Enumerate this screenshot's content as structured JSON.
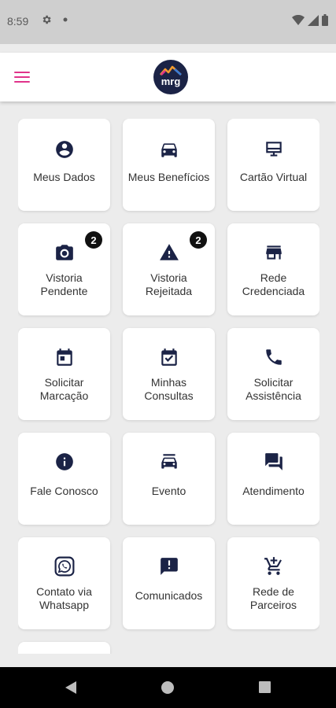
{
  "status_bar": {
    "time": "8:59",
    "icons": [
      "gear-icon",
      "dot-icon",
      "wifi-icon",
      "signal-icon",
      "battery-icon"
    ]
  },
  "app_bar": {
    "menu_icon": "hamburger-menu-icon",
    "logo_text": "mrg",
    "accent_color": "#e0338a",
    "logo_bg": "#1b2346"
  },
  "tiles": [
    {
      "label": "Meus Dados",
      "icon": "account-circle-icon"
    },
    {
      "label": "Meus Benefícios",
      "icon": "car-icon"
    },
    {
      "label": "Cartão Virtual",
      "icon": "card-monitor-icon"
    },
    {
      "label_lines": [
        "Vistoria",
        "Pendente"
      ],
      "icon": "camera-icon",
      "badge": "2"
    },
    {
      "label_lines": [
        "Vistoria",
        "Rejeitada"
      ],
      "icon": "warning-icon",
      "badge": "2"
    },
    {
      "label_lines": [
        "Rede",
        "Credenciada"
      ],
      "icon": "store-icon"
    },
    {
      "label_lines": [
        "Solicitar",
        "Marcação"
      ],
      "icon": "calendar-icon"
    },
    {
      "label_lines": [
        "Minhas",
        "Consultas"
      ],
      "icon": "calendar-check-icon"
    },
    {
      "label_lines": [
        "Solicitar",
        "Assistência"
      ],
      "icon": "phone-icon"
    },
    {
      "label": "Fale Conosco",
      "icon": "info-icon"
    },
    {
      "label": "Evento",
      "icon": "car-event-icon"
    },
    {
      "label": "Atendimento",
      "icon": "forum-icon"
    },
    {
      "label_lines": [
        "Contato via",
        "Whatsapp"
      ],
      "icon": "whatsapp-icon"
    },
    {
      "label": "Comunicados",
      "icon": "announcement-icon"
    },
    {
      "label_lines": [
        "Rede de",
        "Parceiros"
      ],
      "icon": "add-shopping-cart-icon"
    }
  ],
  "nav_bar": {
    "back_icon": "back-icon",
    "home_icon": "home-icon",
    "recents_icon": "recents-icon"
  }
}
